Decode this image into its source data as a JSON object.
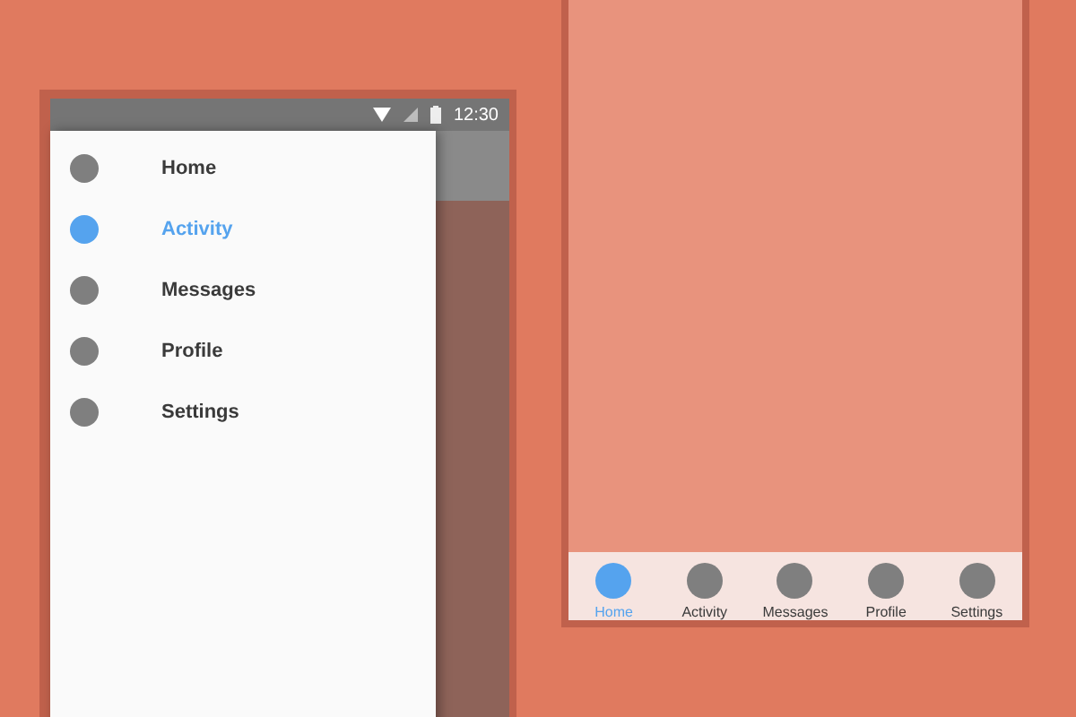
{
  "left_phone": {
    "status_bar": {
      "time": "12:30"
    },
    "drawer": {
      "items": [
        {
          "label": "Home",
          "selected": false
        },
        {
          "label": "Activity",
          "selected": true
        },
        {
          "label": "Messages",
          "selected": false
        },
        {
          "label": "Profile",
          "selected": false
        },
        {
          "label": "Settings",
          "selected": false
        }
      ]
    }
  },
  "right_phone": {
    "bottom_nav": {
      "items": [
        {
          "label": "Home",
          "selected": true
        },
        {
          "label": "Activity",
          "selected": false
        },
        {
          "label": "Messages",
          "selected": false
        },
        {
          "label": "Profile",
          "selected": false
        },
        {
          "label": "Settings",
          "selected": false
        }
      ]
    }
  }
}
